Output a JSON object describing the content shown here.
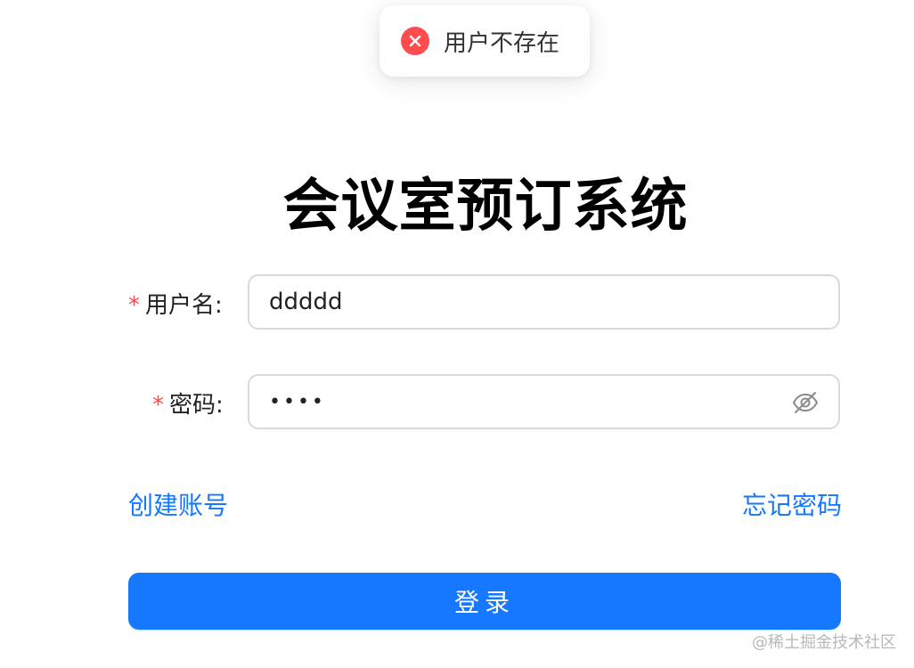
{
  "toast": {
    "type": "error",
    "message": "用户不存在",
    "icon": "close-circle-icon",
    "icon_color": "#ff4d4f"
  },
  "title": "会议室预订系统",
  "form": {
    "required_mark": "*",
    "username": {
      "label": "用户名:",
      "value": "ddddd"
    },
    "password": {
      "label": "密码:",
      "value": "••••",
      "visibility_icon": "eye-invisible-icon"
    }
  },
  "links": {
    "create_account": "创建账号",
    "forgot_password": "忘记密码"
  },
  "login_button": "登录",
  "watermark": "@稀土掘金技术社区",
  "colors": {
    "primary": "#1677ff",
    "error": "#ff4d4f",
    "border": "#d9d9d9"
  }
}
